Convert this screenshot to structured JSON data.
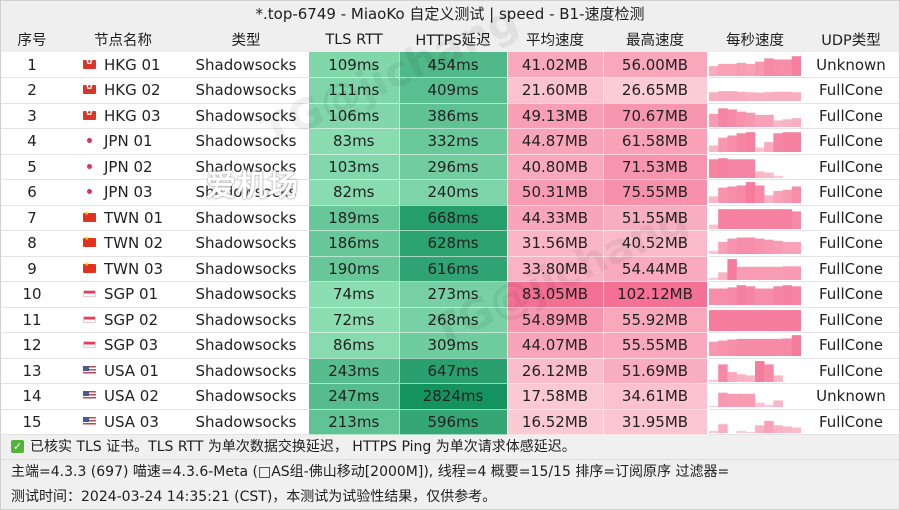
{
  "window": {
    "title": "*.top-6749 - MiaoKo 自定义测试 | speed - B1-速度检测"
  },
  "table": {
    "headers": [
      "序号",
      "节点名称",
      "类型",
      "TLS RTT",
      "HTTPS延迟",
      "平均速度",
      "最高速度",
      "每秒速度",
      "UDP类型"
    ],
    "rows": [
      {
        "index": "1",
        "flag": "hk",
        "name": "HKG 01",
        "type": "Shadowsocks",
        "tls_rtt": "109ms",
        "https": "454ms",
        "avg": "41.02MB",
        "max": "56.00MB",
        "udp": "Unknown",
        "per_second": [
          0.45,
          0.55,
          0.55,
          0.6,
          0.55,
          0.65,
          0.8,
          0.75,
          0.75,
          0.9
        ]
      },
      {
        "index": "2",
        "flag": "hk",
        "name": "HKG 02",
        "type": "Shadowsocks",
        "tls_rtt": "111ms",
        "https": "409ms",
        "avg": "21.60MB",
        "max": "26.65MB",
        "udp": "FullCone",
        "per_second": [
          0.4,
          0.45,
          0.45,
          0.42,
          0.4,
          0.38,
          0.4,
          0.42,
          0.42,
          0.4
        ]
      },
      {
        "index": "3",
        "flag": "hk",
        "name": "HKG 03",
        "type": "Shadowsocks",
        "tls_rtt": "106ms",
        "https": "386ms",
        "avg": "49.13MB",
        "max": "70.67MB",
        "udp": "FullCone",
        "per_second": [
          0.6,
          0.85,
          0.8,
          0.7,
          0.65,
          0.55,
          0.55,
          0.3,
          0.35,
          0.4
        ]
      },
      {
        "index": "4",
        "flag": "jp",
        "name": "JPN 01",
        "type": "Shadowsocks",
        "tls_rtt": "83ms",
        "https": "332ms",
        "avg": "44.87MB",
        "max": "61.58MB",
        "udp": "FullCone",
        "per_second": [
          0.3,
          0.65,
          0.75,
          0.85,
          0.9,
          0.2,
          0.45,
          0.85,
          0.9,
          0.9
        ]
      },
      {
        "index": "5",
        "flag": "jp",
        "name": "JPN 02",
        "type": "Shadowsocks",
        "tls_rtt": "103ms",
        "https": "296ms",
        "avg": "40.80MB",
        "max": "71.53MB",
        "udp": "FullCone",
        "per_second": [
          0.85,
          0.9,
          0.85,
          0.85,
          0.85,
          0.3,
          0.25,
          0.1,
          0.0,
          0.0
        ]
      },
      {
        "index": "6",
        "flag": "jp",
        "name": "JPN 03",
        "type": "Shadowsocks",
        "tls_rtt": "82ms",
        "https": "240ms",
        "avg": "50.31MB",
        "max": "75.55MB",
        "udp": "FullCone",
        "per_second": [
          0.3,
          0.7,
          0.75,
          0.8,
          0.95,
          0.8,
          0.35,
          0.55,
          0.6,
          0.75
        ]
      },
      {
        "index": "7",
        "flag": "tw",
        "name": "TWN 01",
        "type": "Shadowsocks",
        "tls_rtt": "189ms",
        "https": "668ms",
        "avg": "44.33MB",
        "max": "51.55MB",
        "udp": "FullCone",
        "per_second": [
          0.2,
          0.9,
          0.9,
          0.9,
          0.9,
          0.9,
          0.9,
          0.9,
          0.9,
          0.8
        ]
      },
      {
        "index": "8",
        "flag": "tw",
        "name": "TWN 02",
        "type": "Shadowsocks",
        "tls_rtt": "186ms",
        "https": "628ms",
        "avg": "31.56MB",
        "max": "40.52MB",
        "udp": "FullCone",
        "per_second": [
          0.15,
          0.55,
          0.7,
          0.75,
          0.75,
          0.7,
          0.65,
          0.6,
          0.55,
          0.55
        ]
      },
      {
        "index": "9",
        "flag": "tw",
        "name": "TWN 03",
        "type": "Shadowsocks",
        "tls_rtt": "190ms",
        "https": "616ms",
        "avg": "33.80MB",
        "max": "54.44MB",
        "udp": "FullCone",
        "per_second": [
          0.1,
          0.35,
          0.95,
          0.6,
          0.6,
          0.6,
          0.6,
          0.6,
          0.62,
          0.62
        ]
      },
      {
        "index": "10",
        "flag": "sg",
        "name": "SGP 01",
        "type": "Shadowsocks",
        "tls_rtt": "74ms",
        "https": "273ms",
        "avg": "83.05MB",
        "max": "102.12MB",
        "udp": "FullCone",
        "per_second": [
          0.75,
          0.75,
          0.8,
          0.9,
          0.85,
          0.75,
          0.75,
          0.85,
          0.9,
          0.85
        ]
      },
      {
        "index": "11",
        "flag": "sg",
        "name": "SGP 02",
        "type": "Shadowsocks",
        "tls_rtt": "72ms",
        "https": "268ms",
        "avg": "54.89MB",
        "max": "55.92MB",
        "udp": "FullCone",
        "per_second": [
          0.95,
          0.95,
          0.95,
          0.95,
          0.95,
          0.95,
          0.95,
          0.95,
          0.95,
          0.95
        ]
      },
      {
        "index": "12",
        "flag": "sg",
        "name": "SGP 03",
        "type": "Shadowsocks",
        "tls_rtt": "86ms",
        "https": "309ms",
        "avg": "44.07MB",
        "max": "55.55MB",
        "udp": "FullCone",
        "per_second": [
          0.65,
          0.7,
          0.75,
          0.78,
          0.78,
          0.78,
          0.78,
          0.78,
          0.8,
          0.95
        ]
      },
      {
        "index": "13",
        "flag": "us",
        "name": "USA 01",
        "type": "Shadowsocks",
        "tls_rtt": "243ms",
        "https": "647ms",
        "avg": "26.12MB",
        "max": "51.69MB",
        "udp": "FullCone",
        "per_second": [
          0.1,
          0.8,
          0.45,
          0.35,
          0.3,
          0.95,
          0.8,
          0.3,
          0.0,
          0.0
        ]
      },
      {
        "index": "14",
        "flag": "us",
        "name": "USA 02",
        "type": "Shadowsocks",
        "tls_rtt": "247ms",
        "https": "2824ms",
        "avg": "17.58MB",
        "max": "34.61MB",
        "udp": "Unknown",
        "per_second": [
          0.05,
          0.65,
          0.6,
          0.6,
          0.6,
          0.2,
          0.1,
          0.3,
          0.0,
          0.0
        ]
      },
      {
        "index": "15",
        "flag": "us",
        "name": "USA 03",
        "type": "Shadowsocks",
        "tls_rtt": "213ms",
        "https": "596ms",
        "avg": "16.52MB",
        "max": "31.95MB",
        "udp": "FullCone",
        "per_second": [
          0.1,
          0.4,
          0.0,
          0.1,
          0.05,
          0.35,
          0.55,
          0.35,
          0.3,
          0.25
        ]
      }
    ]
  },
  "footer": {
    "line1": "已核实 TLS 证书。TLS RTT 为单次数据交换延迟， HTTPS Ping 为单次请求体感延迟。",
    "line2": "主端=4.3.3 (697) 喵速=4.3.6-Meta (□AS组-佛山移动[2000M]), 线程=4 概要=15/15 排序=订阅原序 过滤器=",
    "line3": "测试时间：2024-03-24 14:35:21 (CST)，本测试为试验性结果，仅供参考。"
  },
  "watermark": {
    "logo_text": "爱机场",
    "text": "TG@jichang"
  },
  "colors": {
    "green_light": "#8fe0b5",
    "green_dark": "#14935f",
    "pink_light": "#fcd3dc",
    "pink_dark": "#f46d91",
    "check": "#56b33a"
  }
}
